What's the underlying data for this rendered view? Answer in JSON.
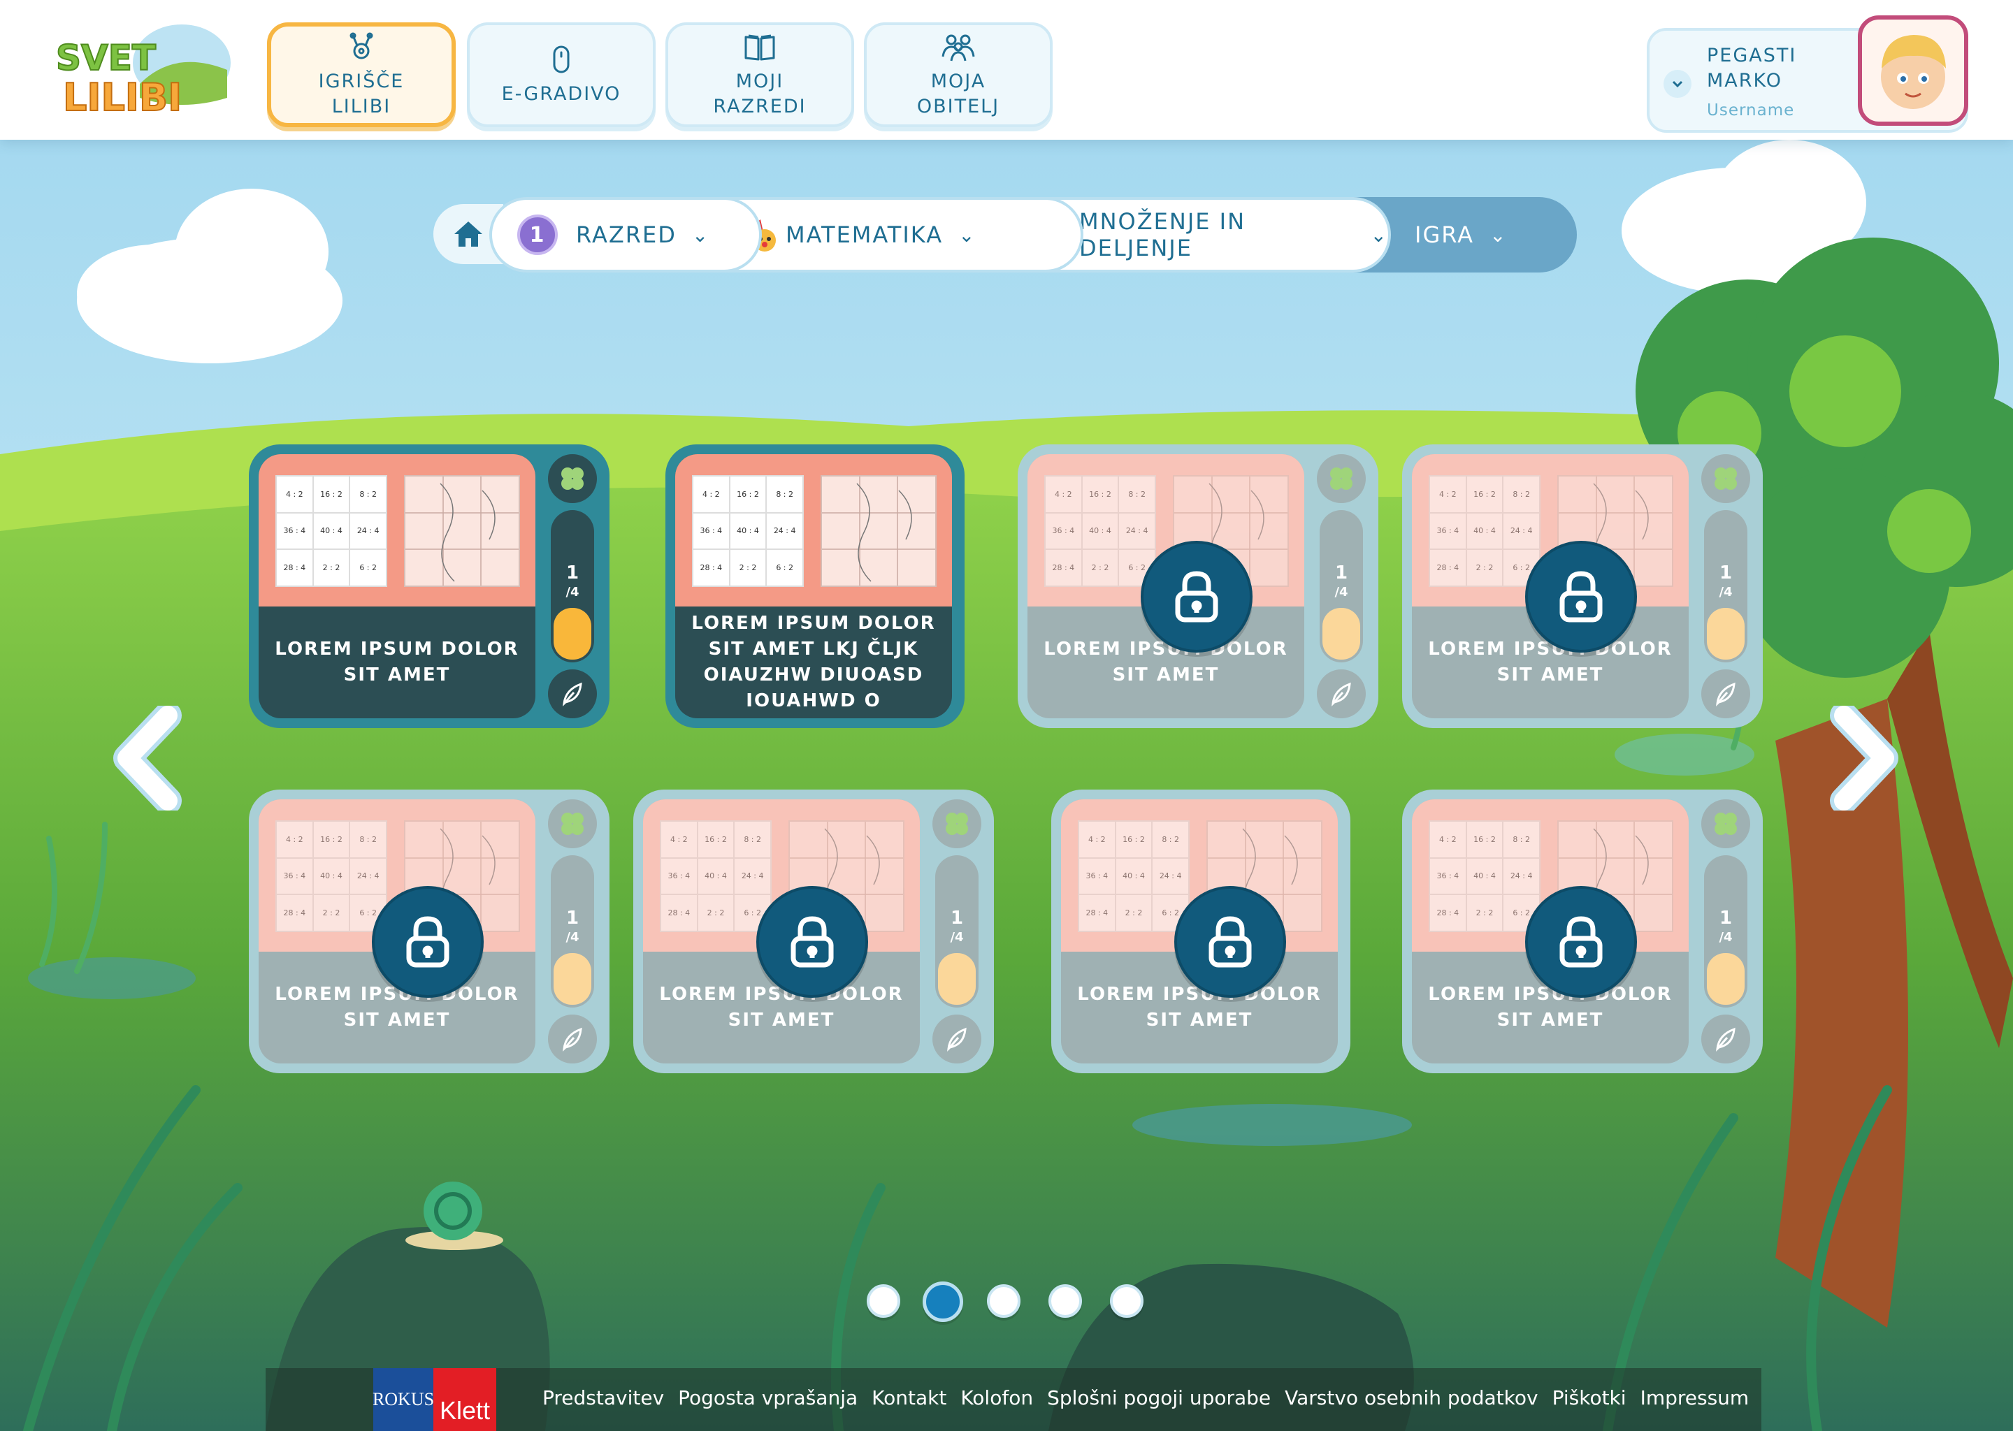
{
  "logo": {
    "text_top": "SVET",
    "text_bottom": "LILIBI"
  },
  "nav": [
    {
      "label": "IGRIŠČE\nLILIBI",
      "icon": "ant-icon",
      "active": true
    },
    {
      "label": "E-GRADIVO",
      "icon": "mouse-icon",
      "active": false
    },
    {
      "label": "MOJI\nRAZREDI",
      "icon": "book-icon",
      "active": false
    },
    {
      "label": "MOJA\nOBITELJ",
      "icon": "family-icon",
      "active": false
    }
  ],
  "user": {
    "name": "PEGASTI\nMARKO",
    "sub": "Username"
  },
  "breadcrumb": [
    {
      "label": "RAZRED",
      "badge": "1"
    },
    {
      "label": "MATEMATIKA"
    },
    {
      "label": "MNOŽENJE IN DELJENJE"
    },
    {
      "label": "IGRA"
    }
  ],
  "cards": [
    {
      "title": "LOREM IPSUM DOLOR SIT AMET",
      "locked": false,
      "progress": "1",
      "progress_total": "/4",
      "fill": 0.35
    },
    {
      "title": "LOREM IPSUM DOLOR SIT AMET LKJ ČLJK OIAUZHW DIUOASD IOUAHWD O",
      "locked": false
    },
    {
      "title": "LOREM IPSUM DOLOR SIT AMET",
      "locked": true,
      "progress": "1",
      "progress_total": "/4",
      "fill": 0.35
    },
    {
      "title": "LOREM IPSUM DOLOR SIT AMET",
      "locked": true,
      "progress": "1",
      "progress_total": "/4",
      "fill": 0.35
    },
    {
      "title": "LOREM IPSUM DOLOR SIT AMET",
      "locked": true,
      "progress": "1",
      "progress_total": "/4",
      "fill": 0.35
    },
    {
      "title": "LOREM IPSUM DOLOR SIT AMET",
      "locked": true,
      "progress": "1",
      "progress_total": "/4",
      "fill": 0.35
    },
    {
      "title": "LOREM IPSUM DOLOR SIT AMET",
      "locked": true
    },
    {
      "title": "LOREM IPSUM DOLOR SIT AMET",
      "locked": true,
      "progress": "1",
      "progress_total": "/4",
      "fill": 0.35
    }
  ],
  "thumb_grid": [
    "4 : 2",
    "16 : 2",
    "8 : 2",
    "36 : 4",
    "40 : 4",
    "24 : 4",
    "28 : 4",
    "2 : 2",
    "6 : 2"
  ],
  "pagination": {
    "pages": 5,
    "active": 2
  },
  "footer": {
    "logo_left": "ROKUS",
    "logo_right": "Klett",
    "links": [
      "Predstavitev",
      "Pogosta vprašanja",
      "Kontakt",
      "Kolofon",
      "Splošni pogoji uporabe",
      "Varstvo osebnih podatkov",
      "Piškotki",
      "Impressum"
    ]
  },
  "colors": {
    "primary": "#1f6e92",
    "accent": "#f7b642",
    "lock": "#115a7c",
    "card_active": "#2f8a99"
  }
}
